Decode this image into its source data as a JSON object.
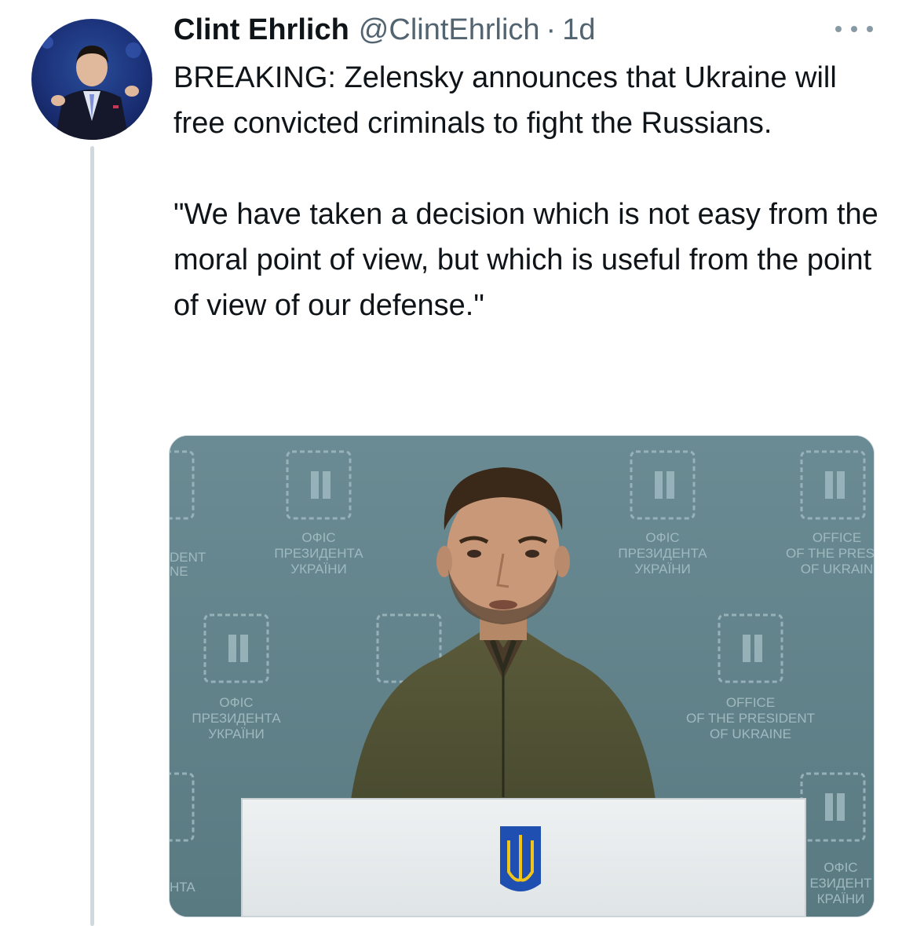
{
  "author": {
    "name": "Clint Ehrlich",
    "handle": "@ClintEhrlich",
    "separator": "·",
    "time": "1d"
  },
  "icons": {
    "more": "more-horizontal-icon",
    "avatar": "profile-avatar"
  },
  "tweet": {
    "line1": "BREAKING: Zelensky announces that Ukraine will free convicted criminals to fight the Russians.",
    "line2": "\"We have taken a decision which is not easy from the moral point of view, but which is useful from the point of view of our defense.\""
  },
  "media": {
    "backdrop_texts": [
      "ОФІС",
      "ПРЕЗИДЕНТА",
      "УКРАЇНИ",
      "OFFICE",
      "OF THE PRESIDENT",
      "OF UKRAINE",
      "DENT",
      "NE",
      "HTA",
      "OF THE PRESID",
      "OF UKRAIN",
      "ЕЗИДЕНТ",
      "КРАЇНИ"
    ]
  },
  "colors": {
    "text": "#0f1419",
    "muted": "#536471",
    "thread": "#cfd9de",
    "backdrop": "#5f7f88"
  }
}
